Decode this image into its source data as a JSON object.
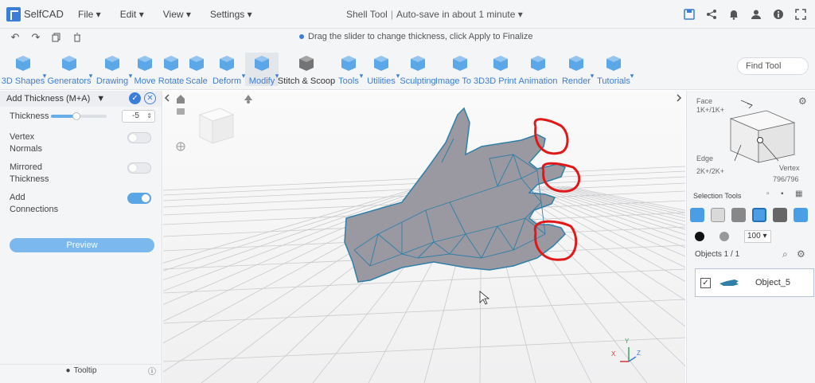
{
  "app": {
    "name": "SelfCAD"
  },
  "menu": [
    "File",
    "Edit",
    "View",
    "Settings"
  ],
  "title": {
    "tool": "Shell Tool",
    "autosave": "Auto-save in about 1 minute"
  },
  "hint": "Drag the slider to change thickness, click Apply to Finalize",
  "toolbar": [
    {
      "label": "3D Shapes",
      "dropdown": true
    },
    {
      "label": "Generators",
      "dropdown": true
    },
    {
      "label": "Drawing",
      "dropdown": true
    },
    {
      "label": "Move",
      "dropdown": false
    },
    {
      "label": "Rotate",
      "dropdown": false
    },
    {
      "label": "Scale",
      "dropdown": false
    },
    {
      "label": "Deform",
      "dropdown": true
    },
    {
      "label": "Modify",
      "dropdown": true
    },
    {
      "label": "Stitch & Scoop",
      "dropdown": false
    },
    {
      "label": "Tools",
      "dropdown": true
    },
    {
      "label": "Utilities",
      "dropdown": true
    },
    {
      "label": "Sculpting",
      "dropdown": false
    },
    {
      "label": "Image To 3D",
      "dropdown": false
    },
    {
      "label": "3D Print",
      "dropdown": false
    },
    {
      "label": "Animation",
      "dropdown": false
    },
    {
      "label": "Render",
      "dropdown": true
    },
    {
      "label": "Tutorials",
      "dropdown": true
    }
  ],
  "search": {
    "placeholder": "Find Tool"
  },
  "panel": {
    "title": "Add Thickness (M+A)",
    "thickness_label": "Thickness",
    "thickness_value": "-5",
    "thickness_fraction": 0.45,
    "vertex_normals_label": [
      "Vertex",
      "Normals"
    ],
    "vertex_normals_on": false,
    "mirrored_label": [
      "Mirrored",
      "Thickness"
    ],
    "mirrored_on": false,
    "connections_label": [
      "Add",
      "Connections"
    ],
    "connections_on": true,
    "preview_label": "Preview",
    "tooltip_label": "Tooltip"
  },
  "selection_cube": {
    "face_label": "Face",
    "face_count": "1K+/1K+",
    "edge_label": "Edge",
    "edge_count": "2K+/2K+",
    "vertex_label": "Vertex",
    "vertex_count": "796/796"
  },
  "right": {
    "selection_tools_label": "Selection Tools",
    "brush_value": "100",
    "objects_label": "Objects 1 / 1",
    "object_name": "Object_5"
  },
  "axis": {
    "x": "X",
    "y": "Y",
    "z": "Z"
  },
  "colors": {
    "accent": "#3b7dd8",
    "mesh": "#2f7fa8",
    "annotation": "#e01818"
  }
}
